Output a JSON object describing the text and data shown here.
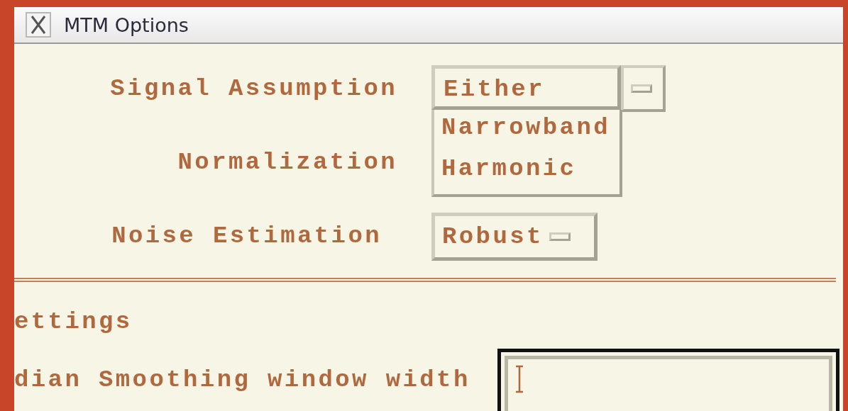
{
  "window": {
    "title": "MTM Options"
  },
  "options": [
    {
      "label": "Signal Assumption",
      "value": "Either",
      "expanded": true,
      "menu_items": [
        "Narrowband",
        "Harmonic"
      ]
    },
    {
      "label": "Normalization"
    },
    {
      "label": "Noise Estimation",
      "value": "Robust",
      "expanded": false
    }
  ],
  "section_title": "ettings",
  "fields": [
    {
      "label": "dian Smoothing window width",
      "focused": true
    }
  ]
}
